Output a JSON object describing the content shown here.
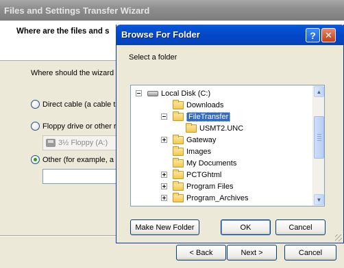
{
  "wizard": {
    "title": "Files and Settings Transfer Wizard",
    "heading": "Where are the files and s",
    "question": "Where should the wizard l",
    "options": [
      {
        "label": "Direct cable (a cable th",
        "selected": false
      },
      {
        "label": "Floppy drive or other re",
        "selected": false
      },
      {
        "label": "Other (for example, a re",
        "selected": true
      }
    ],
    "floppy_combo": "3½ Floppy (A:)",
    "path_value": "",
    "buttons": {
      "back": "< Back",
      "next": "Next >",
      "cancel": "Cancel"
    }
  },
  "dialog": {
    "title": "Browse For Folder",
    "help_glyph": "?",
    "close_glyph": "✕",
    "prompt": "Select a folder",
    "tree": [
      {
        "label": "Local Disk (C:)",
        "type": "drive",
        "expander": "minus",
        "level": 0,
        "selected": false
      },
      {
        "label": "Downloads",
        "type": "folder",
        "expander": "",
        "level": 1,
        "selected": false
      },
      {
        "label": "FileTransfer",
        "type": "folder",
        "expander": "minus",
        "level": 1,
        "selected": true
      },
      {
        "label": "USMT2.UNC",
        "type": "folder",
        "expander": "",
        "level": 2,
        "selected": false
      },
      {
        "label": "Gateway",
        "type": "folder",
        "expander": "plus",
        "level": 1,
        "selected": false
      },
      {
        "label": "Images",
        "type": "folder",
        "expander": "",
        "level": 1,
        "selected": false
      },
      {
        "label": "My Documents",
        "type": "folder",
        "expander": "",
        "level": 1,
        "selected": false
      },
      {
        "label": "PCTGhtml",
        "type": "folder",
        "expander": "plus",
        "level": 1,
        "selected": false
      },
      {
        "label": "Program Files",
        "type": "folder",
        "expander": "plus",
        "level": 1,
        "selected": false
      },
      {
        "label": "Program_Archives",
        "type": "folder",
        "expander": "plus",
        "level": 1,
        "selected": false
      }
    ],
    "buttons": {
      "make_new_folder": "Make New Folder",
      "ok": "OK",
      "cancel": "Cancel"
    }
  }
}
